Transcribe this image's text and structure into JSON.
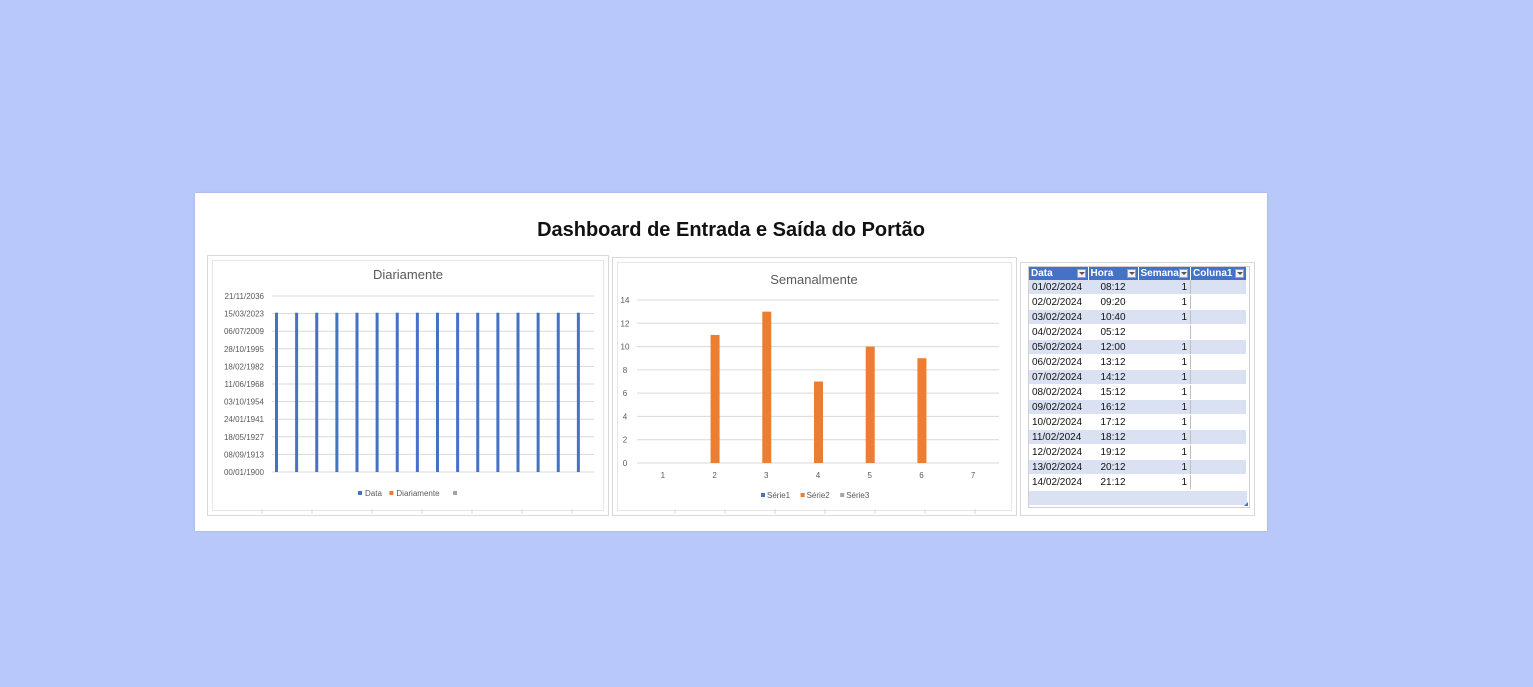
{
  "dashboard": {
    "title": "Dashboard de Entrada e Saída do Portão"
  },
  "chart_data": [
    {
      "type": "bar",
      "title": "Diariamente",
      "y_tick_labels": [
        "21/11/2036",
        "15/03/2023",
        "06/07/2009",
        "28/10/1995",
        "18/02/1982",
        "11/06/1968",
        "03/10/1954",
        "24/01/1941",
        "18/05/1927",
        "08/09/1913",
        "00/01/1900"
      ],
      "y_value_fraction": 0.905,
      "bar_count": 16,
      "series": [
        {
          "name": "Data",
          "color": "#4472c4"
        },
        {
          "name": "Diariamente",
          "color": "#ed7d31"
        },
        {
          "name": "",
          "color": "#a5a5a5"
        }
      ],
      "legend_position": "bottom",
      "grid": true
    },
    {
      "type": "bar",
      "title": "Semanalmente",
      "categories": [
        "1",
        "2",
        "3",
        "4",
        "5",
        "6",
        "7"
      ],
      "ylim": [
        0,
        14
      ],
      "y_ticks": [
        0,
        2,
        4,
        6,
        8,
        10,
        12,
        14
      ],
      "series": [
        {
          "name": "Série1",
          "color": "#4472c4",
          "values": [
            0,
            0,
            0,
            0,
            0,
            0,
            0
          ]
        },
        {
          "name": "Série2",
          "color": "#ed7d31",
          "values": [
            0,
            11,
            13,
            7,
            10,
            9,
            0
          ]
        },
        {
          "name": "Série3",
          "color": "#a5a5a5",
          "values": [
            0,
            0,
            0,
            0,
            0,
            0,
            0
          ]
        }
      ],
      "legend_position": "bottom",
      "grid": true
    }
  ],
  "table": {
    "headers": [
      "Data",
      "Hora",
      "Semana",
      "Coluna1"
    ],
    "rows": [
      [
        "01/02/2024",
        "08:12",
        "1",
        ""
      ],
      [
        "02/02/2024",
        "09:20",
        "1",
        ""
      ],
      [
        "03/02/2024",
        "10:40",
        "1",
        ""
      ],
      [
        "04/02/2024",
        "05:12",
        "",
        ""
      ],
      [
        "05/02/2024",
        "12:00",
        "1",
        ""
      ],
      [
        "06/02/2024",
        "13:12",
        "1",
        ""
      ],
      [
        "07/02/2024",
        "14:12",
        "1",
        ""
      ],
      [
        "08/02/2024",
        "15:12",
        "1",
        ""
      ],
      [
        "09/02/2024",
        "16:12",
        "1",
        ""
      ],
      [
        "10/02/2024",
        "17:12",
        "1",
        ""
      ],
      [
        "11/02/2024",
        "18:12",
        "1",
        ""
      ],
      [
        "12/02/2024",
        "19:12",
        "1",
        ""
      ],
      [
        "13/02/2024",
        "20:12",
        "1",
        ""
      ],
      [
        "14/02/2024",
        "21:12",
        "1",
        ""
      ]
    ]
  }
}
